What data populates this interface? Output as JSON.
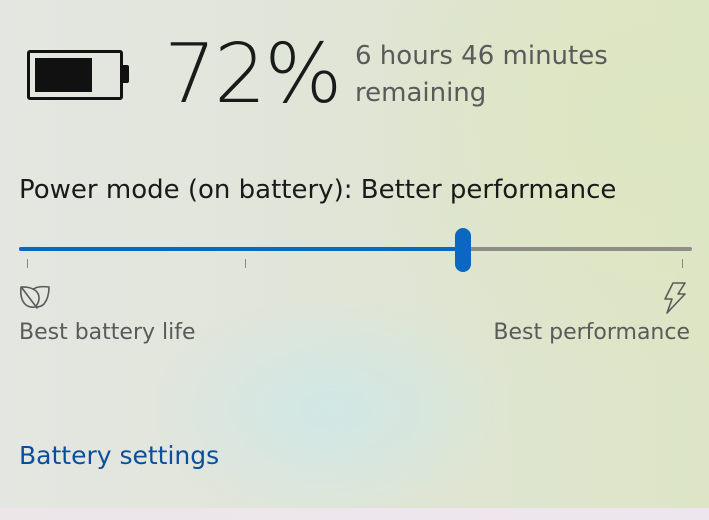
{
  "battery": {
    "percent_label": "72%",
    "charge_fraction": 0.72,
    "remaining_label": "6 hours 46 minutes remaining",
    "icon": "battery-icon"
  },
  "power_mode": {
    "label": "Power mode (on battery): Better performance",
    "slider_value": 0.66,
    "min_label": "Best battery life",
    "max_label": "Best performance",
    "min_icon": "leaf-icon",
    "max_icon": "lightning-bolt-icon"
  },
  "links": {
    "battery_settings": "Battery settings"
  },
  "colors": {
    "accent": "#0a67c2",
    "link": "#0b4f9a",
    "track": "#8e8e87"
  }
}
